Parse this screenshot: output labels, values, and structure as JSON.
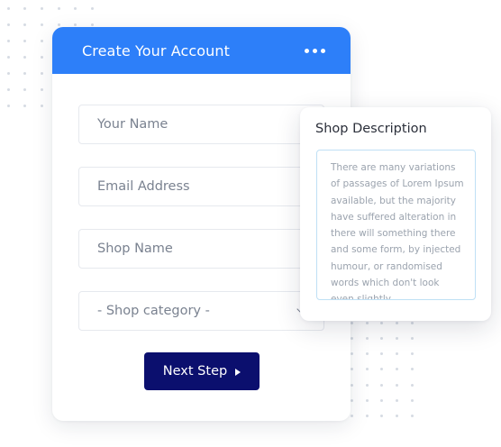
{
  "form": {
    "title": "Create Your Account",
    "fields": {
      "name_placeholder": "Your Name",
      "email_placeholder": "Email Address",
      "shop_placeholder": "Shop Name",
      "category_selected": "- Shop category -"
    },
    "next_button_label": "Next Step",
    "header_color": "#2d7ff9",
    "button_color": "#0b0f6e"
  },
  "description": {
    "title": "Shop Description",
    "text": "There are many variations of passages of Lorem Ipsum available, but the majority have suffered alteration in there will something there and some form, by injected humour, or randomised words which don't look even slightly"
  }
}
